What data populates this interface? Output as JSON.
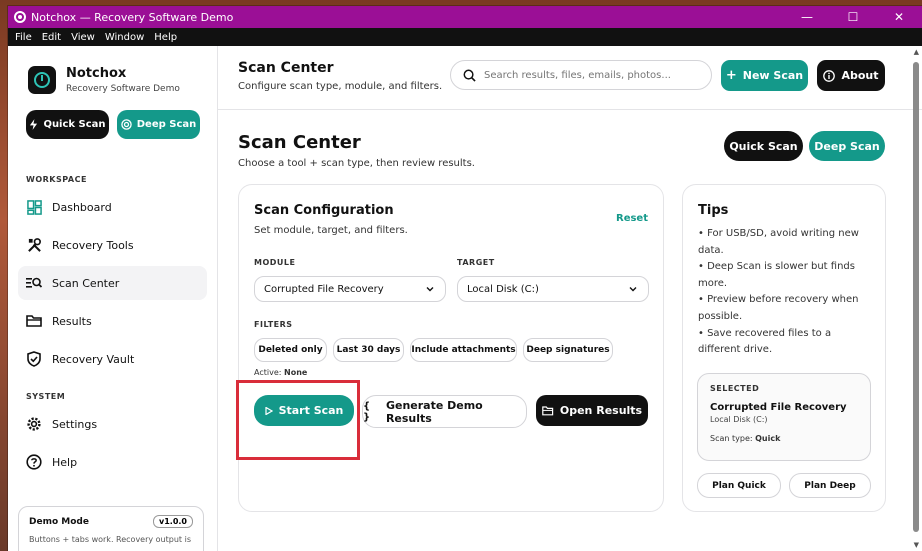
{
  "window": {
    "title": "Notchox — Recovery Software Demo",
    "controls": [
      "—",
      "☐",
      "✕"
    ]
  },
  "menubar": [
    "File",
    "Edit",
    "View",
    "Window",
    "Help"
  ],
  "sidebar": {
    "brand_name": "Notchox",
    "brand_sub": "Recovery Software Demo",
    "quick_scan": "Quick Scan",
    "deep_scan": "Deep Scan",
    "workspace_label": "WORKSPACE",
    "workspace_items": [
      {
        "label": "Dashboard",
        "icon": "dashboard-icon"
      },
      {
        "label": "Recovery Tools",
        "icon": "tools-icon"
      },
      {
        "label": "Scan Center",
        "icon": "scan-center-icon",
        "active": true
      },
      {
        "label": "Results",
        "icon": "folder-icon"
      },
      {
        "label": "Recovery Vault",
        "icon": "shield-icon"
      }
    ],
    "system_label": "SYSTEM",
    "system_items": [
      {
        "label": "Settings",
        "icon": "gear-icon"
      },
      {
        "label": "Help",
        "icon": "help-icon"
      }
    ],
    "demo": {
      "title": "Demo Mode",
      "version": "v1.0.0",
      "desc": "Buttons + tabs work. Recovery output is"
    }
  },
  "topbar": {
    "title": "Scan Center",
    "subtitle": "Configure scan type, module, and filters.",
    "search_placeholder": "Search results, files, emails, photos...",
    "new_scan": "New Scan",
    "about": "About"
  },
  "page": {
    "title": "Scan Center",
    "subtitle": "Choose a tool + scan type, then review results.",
    "quick_scan": "Quick Scan",
    "deep_scan": "Deep Scan"
  },
  "config": {
    "title": "Scan Configuration",
    "subtitle": "Set module, target, and filters.",
    "reset": "Reset",
    "module_label": "MODULE",
    "module_value": "Corrupted File Recovery",
    "target_label": "TARGET",
    "target_value": "Local Disk (C:)",
    "filters_label": "FILTERS",
    "filters": [
      "Deleted only",
      "Last 30 days",
      "Include attachments",
      "Deep signatures"
    ],
    "active_label": "Active:",
    "active_value": "None",
    "start_scan": "Start Scan",
    "generate_demo": "Generate Demo Results",
    "open_results": "Open Results"
  },
  "tips": {
    "title": "Tips",
    "items": [
      "• For USB/SD, avoid writing new data.",
      "• Deep Scan is slower but finds more.",
      "• Preview before recovery when possible.",
      "• Save recovered files to a different drive."
    ],
    "selected_label": "SELECTED",
    "selected_name": "Corrupted File Recovery",
    "selected_target": "Local Disk (C:)",
    "scan_type_label": "Scan type:",
    "scan_type_value": "Quick",
    "plan_quick": "Plan Quick",
    "plan_deep": "Plan Deep"
  },
  "colors": {
    "titlebar": "#9b0f96",
    "accent_teal": "#14998a",
    "dark": "#111111",
    "highlight": "#d92d3a"
  }
}
